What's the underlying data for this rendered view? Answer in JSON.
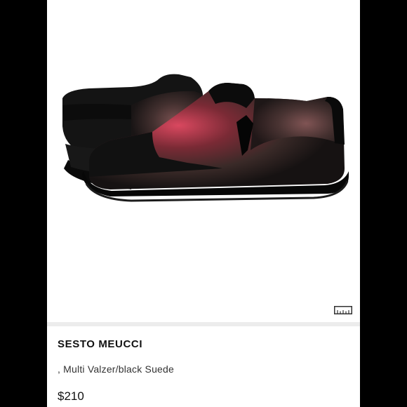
{
  "product": {
    "brand": "SESTO MEUCCI",
    "variant": ", Multi Valzer/black Suede",
    "price": "$210"
  },
  "icons": {
    "size_chart": "ruler-icon"
  },
  "colors": {
    "background": "#000000",
    "card": "#ffffff",
    "divider": "#ececec",
    "shoe_base": "#111111",
    "print_accent": "#d9485f"
  }
}
